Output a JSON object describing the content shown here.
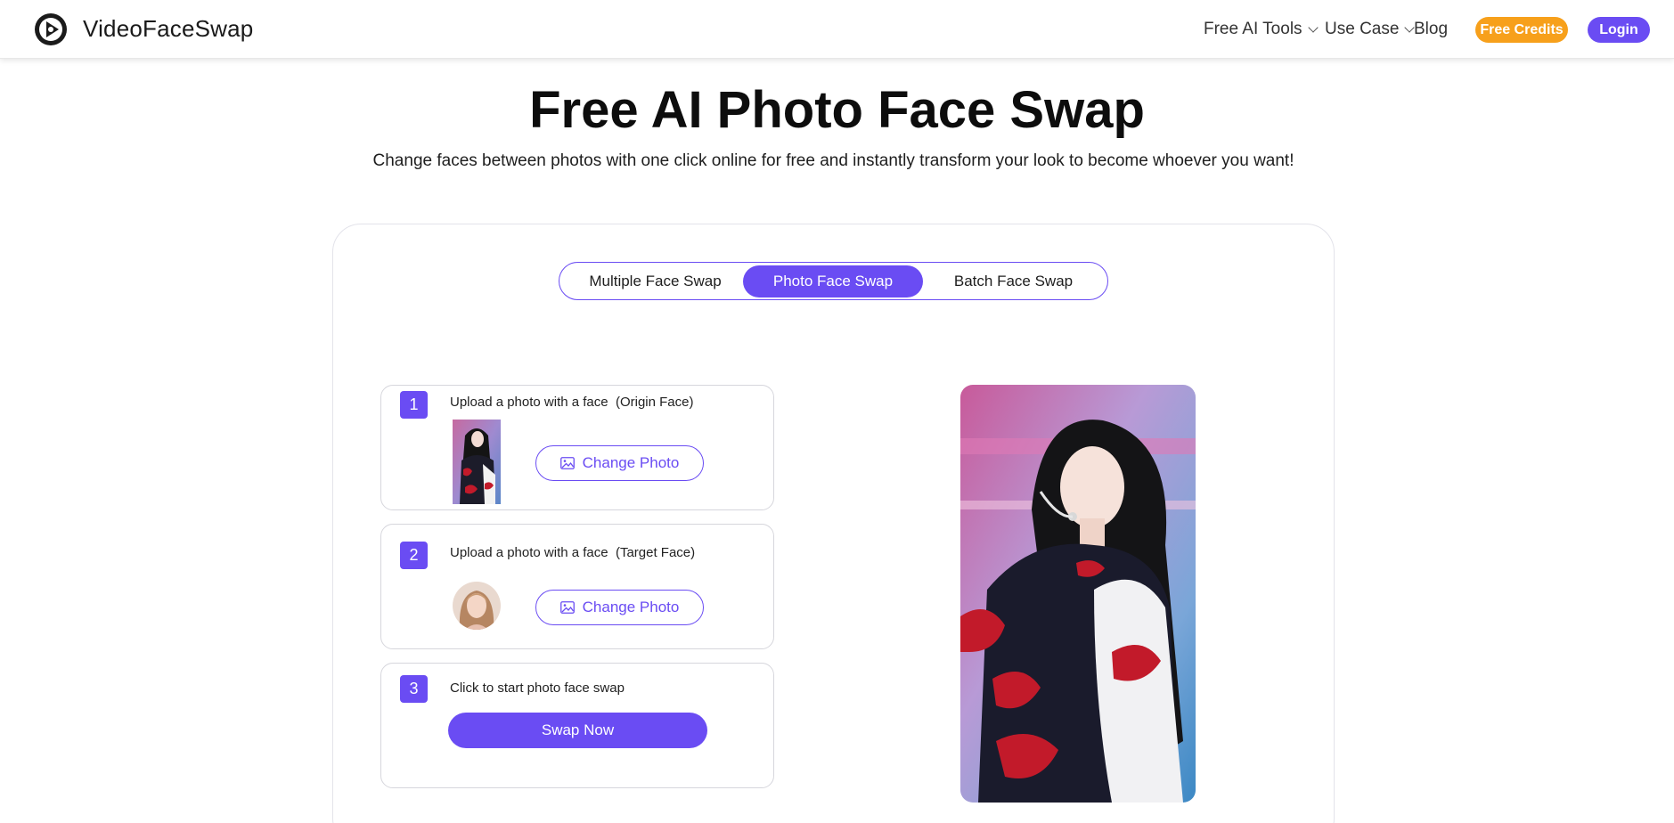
{
  "header": {
    "brand": "VideoFaceSwap",
    "nav": {
      "free_ai_tools": "Free AI Tools",
      "use_case": "Use Case",
      "blog": "Blog"
    },
    "free_credits": "Free Credits",
    "login": "Login"
  },
  "hero": {
    "title": "Free AI Photo Face Swap",
    "subtitle": "Change faces between photos with one click online for free and instantly transform your look to become whoever you want!"
  },
  "tabs": [
    {
      "label": "Multiple Face Swap",
      "active": false
    },
    {
      "label": "Photo Face Swap",
      "active": true
    },
    {
      "label": "Batch Face Swap",
      "active": false
    }
  ],
  "steps": [
    {
      "number": "1",
      "label": "Upload a photo with a face  (Origin Face)",
      "button": "Change Photo"
    },
    {
      "number": "2",
      "label": "Upload a photo with a face  (Target Face)",
      "button": "Change Photo"
    },
    {
      "number": "3",
      "label": "Click to start photo face swap",
      "button": "Swap Now"
    }
  ],
  "colors": {
    "accent": "#6a4cf3",
    "credits": "#f7a01b"
  }
}
